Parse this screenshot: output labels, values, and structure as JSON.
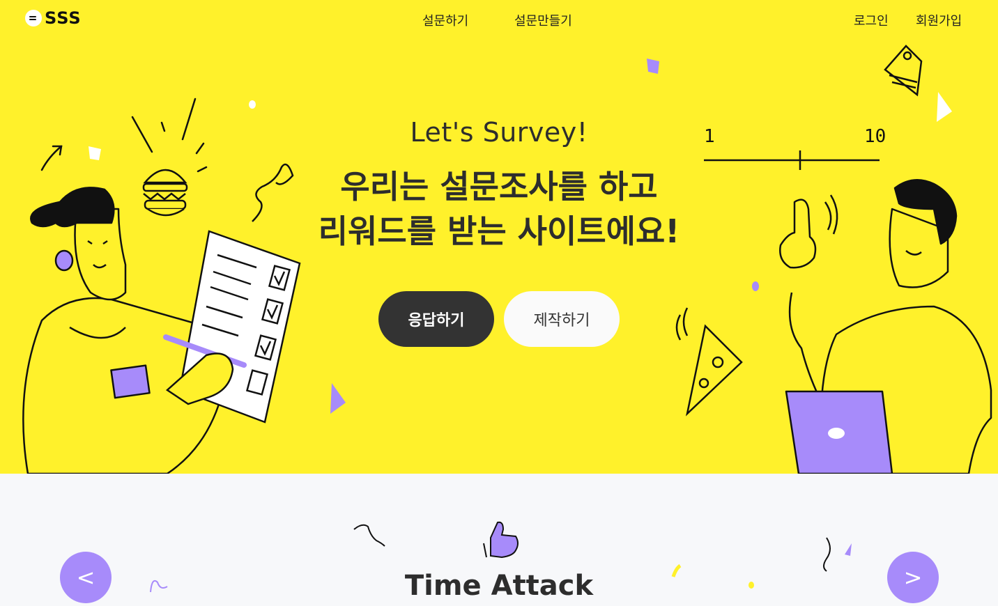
{
  "brand": {
    "name": "SSS"
  },
  "nav": {
    "center": [
      {
        "label": "설문하기"
      },
      {
        "label": "설문만들기"
      }
    ],
    "login": "로그인",
    "signup": "회원가입"
  },
  "hero": {
    "subtitle": "Let's Survey!",
    "headline_line1": "우리는 설문조사를 하고",
    "headline_line2": "리워드를 받는 사이트에요!",
    "respond_button": "응답하기",
    "create_button": "제작하기",
    "scale_min": "1",
    "scale_max": "10"
  },
  "section": {
    "title": "Time Attack",
    "prev_label": "<",
    "next_label": ">"
  },
  "colors": {
    "hero_bg": "#fff12b",
    "accent": "#a78bfa",
    "dark": "#333333"
  }
}
